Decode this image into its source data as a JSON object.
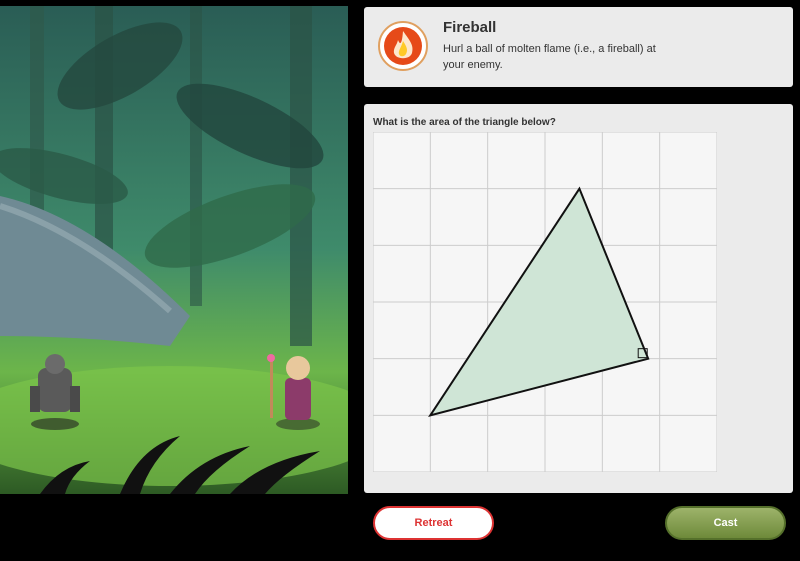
{
  "scene": {
    "enemy_name": "stone golem",
    "hero_name": "mage"
  },
  "spell": {
    "title": "Fireball",
    "description": "Hurl a ball of molten flame (i.e., a fireball) at your enemy.",
    "icon": "fire-icon",
    "accent_color": "#e64a19"
  },
  "question": {
    "prompt": "What is the area of the triangle below?",
    "grid_columns": 6,
    "grid_rows": 6,
    "triangle_vertices": [
      [
        1,
        1
      ],
      [
        3.6,
        5
      ],
      [
        4.8,
        2
      ]
    ],
    "right_angle_vertex": [
      4.8,
      2
    ],
    "fill_color": "#cfe5d6"
  },
  "buttons": {
    "retreat_label": "Retreat",
    "cast_label": "Cast"
  }
}
